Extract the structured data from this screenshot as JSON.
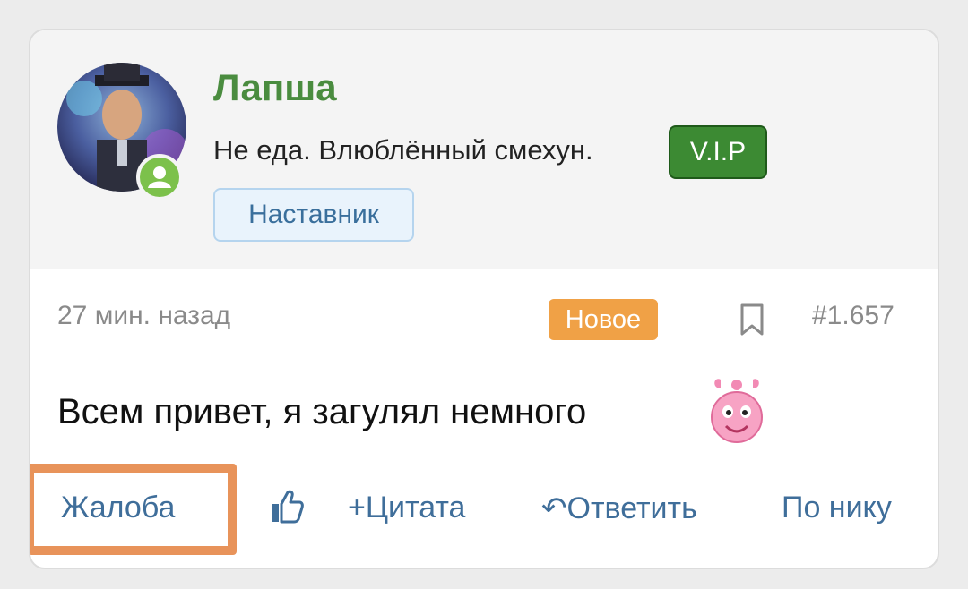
{
  "user": {
    "name": "Лапша",
    "title": "Не еда. Влюблённый смехун.",
    "vip_badge": "V.I.P",
    "role_badge": "Наставник"
  },
  "meta": {
    "time": "27 мин. назад",
    "new_badge": "Новое",
    "post_number": "#1.657"
  },
  "message": {
    "text": "Всем привет, я загулял немного"
  },
  "actions": {
    "report": "Жалоба",
    "quote": "Цитата",
    "reply": "Ответить",
    "by_nick": "По нику"
  },
  "colors": {
    "username": "#4a8c3f",
    "vip": "#3c8a33",
    "new_badge": "#f0a146",
    "link": "#3f6e9a",
    "highlight": "#e8935a"
  }
}
